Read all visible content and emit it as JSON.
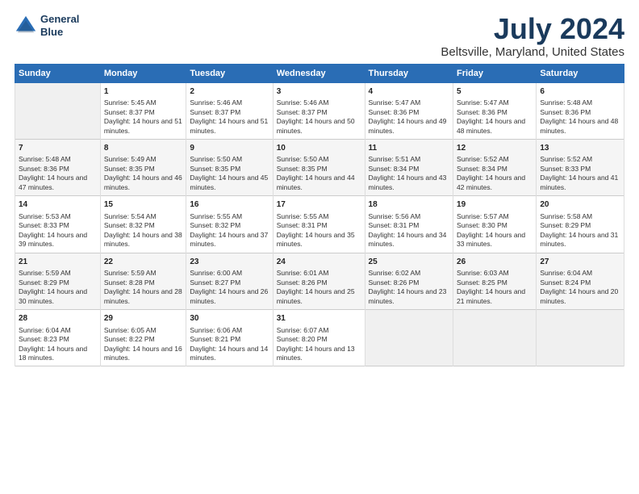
{
  "header": {
    "logo_line1": "General",
    "logo_line2": "Blue",
    "title": "July 2024",
    "subtitle": "Beltsville, Maryland, United States"
  },
  "calendar": {
    "days_of_week": [
      "Sunday",
      "Monday",
      "Tuesday",
      "Wednesday",
      "Thursday",
      "Friday",
      "Saturday"
    ],
    "weeks": [
      [
        {
          "day": "",
          "sunrise": "",
          "sunset": "",
          "daylight": ""
        },
        {
          "day": "1",
          "sunrise": "Sunrise: 5:45 AM",
          "sunset": "Sunset: 8:37 PM",
          "daylight": "Daylight: 14 hours and 51 minutes."
        },
        {
          "day": "2",
          "sunrise": "Sunrise: 5:46 AM",
          "sunset": "Sunset: 8:37 PM",
          "daylight": "Daylight: 14 hours and 51 minutes."
        },
        {
          "day": "3",
          "sunrise": "Sunrise: 5:46 AM",
          "sunset": "Sunset: 8:37 PM",
          "daylight": "Daylight: 14 hours and 50 minutes."
        },
        {
          "day": "4",
          "sunrise": "Sunrise: 5:47 AM",
          "sunset": "Sunset: 8:36 PM",
          "daylight": "Daylight: 14 hours and 49 minutes."
        },
        {
          "day": "5",
          "sunrise": "Sunrise: 5:47 AM",
          "sunset": "Sunset: 8:36 PM",
          "daylight": "Daylight: 14 hours and 48 minutes."
        },
        {
          "day": "6",
          "sunrise": "Sunrise: 5:48 AM",
          "sunset": "Sunset: 8:36 PM",
          "daylight": "Daylight: 14 hours and 48 minutes."
        }
      ],
      [
        {
          "day": "7",
          "sunrise": "Sunrise: 5:48 AM",
          "sunset": "Sunset: 8:36 PM",
          "daylight": "Daylight: 14 hours and 47 minutes."
        },
        {
          "day": "8",
          "sunrise": "Sunrise: 5:49 AM",
          "sunset": "Sunset: 8:35 PM",
          "daylight": "Daylight: 14 hours and 46 minutes."
        },
        {
          "day": "9",
          "sunrise": "Sunrise: 5:50 AM",
          "sunset": "Sunset: 8:35 PM",
          "daylight": "Daylight: 14 hours and 45 minutes."
        },
        {
          "day": "10",
          "sunrise": "Sunrise: 5:50 AM",
          "sunset": "Sunset: 8:35 PM",
          "daylight": "Daylight: 14 hours and 44 minutes."
        },
        {
          "day": "11",
          "sunrise": "Sunrise: 5:51 AM",
          "sunset": "Sunset: 8:34 PM",
          "daylight": "Daylight: 14 hours and 43 minutes."
        },
        {
          "day": "12",
          "sunrise": "Sunrise: 5:52 AM",
          "sunset": "Sunset: 8:34 PM",
          "daylight": "Daylight: 14 hours and 42 minutes."
        },
        {
          "day": "13",
          "sunrise": "Sunrise: 5:52 AM",
          "sunset": "Sunset: 8:33 PM",
          "daylight": "Daylight: 14 hours and 41 minutes."
        }
      ],
      [
        {
          "day": "14",
          "sunrise": "Sunrise: 5:53 AM",
          "sunset": "Sunset: 8:33 PM",
          "daylight": "Daylight: 14 hours and 39 minutes."
        },
        {
          "day": "15",
          "sunrise": "Sunrise: 5:54 AM",
          "sunset": "Sunset: 8:32 PM",
          "daylight": "Daylight: 14 hours and 38 minutes."
        },
        {
          "day": "16",
          "sunrise": "Sunrise: 5:55 AM",
          "sunset": "Sunset: 8:32 PM",
          "daylight": "Daylight: 14 hours and 37 minutes."
        },
        {
          "day": "17",
          "sunrise": "Sunrise: 5:55 AM",
          "sunset": "Sunset: 8:31 PM",
          "daylight": "Daylight: 14 hours and 35 minutes."
        },
        {
          "day": "18",
          "sunrise": "Sunrise: 5:56 AM",
          "sunset": "Sunset: 8:31 PM",
          "daylight": "Daylight: 14 hours and 34 minutes."
        },
        {
          "day": "19",
          "sunrise": "Sunrise: 5:57 AM",
          "sunset": "Sunset: 8:30 PM",
          "daylight": "Daylight: 14 hours and 33 minutes."
        },
        {
          "day": "20",
          "sunrise": "Sunrise: 5:58 AM",
          "sunset": "Sunset: 8:29 PM",
          "daylight": "Daylight: 14 hours and 31 minutes."
        }
      ],
      [
        {
          "day": "21",
          "sunrise": "Sunrise: 5:59 AM",
          "sunset": "Sunset: 8:29 PM",
          "daylight": "Daylight: 14 hours and 30 minutes."
        },
        {
          "day": "22",
          "sunrise": "Sunrise: 5:59 AM",
          "sunset": "Sunset: 8:28 PM",
          "daylight": "Daylight: 14 hours and 28 minutes."
        },
        {
          "day": "23",
          "sunrise": "Sunrise: 6:00 AM",
          "sunset": "Sunset: 8:27 PM",
          "daylight": "Daylight: 14 hours and 26 minutes."
        },
        {
          "day": "24",
          "sunrise": "Sunrise: 6:01 AM",
          "sunset": "Sunset: 8:26 PM",
          "daylight": "Daylight: 14 hours and 25 minutes."
        },
        {
          "day": "25",
          "sunrise": "Sunrise: 6:02 AM",
          "sunset": "Sunset: 8:26 PM",
          "daylight": "Daylight: 14 hours and 23 minutes."
        },
        {
          "day": "26",
          "sunrise": "Sunrise: 6:03 AM",
          "sunset": "Sunset: 8:25 PM",
          "daylight": "Daylight: 14 hours and 21 minutes."
        },
        {
          "day": "27",
          "sunrise": "Sunrise: 6:04 AM",
          "sunset": "Sunset: 8:24 PM",
          "daylight": "Daylight: 14 hours and 20 minutes."
        }
      ],
      [
        {
          "day": "28",
          "sunrise": "Sunrise: 6:04 AM",
          "sunset": "Sunset: 8:23 PM",
          "daylight": "Daylight: 14 hours and 18 minutes."
        },
        {
          "day": "29",
          "sunrise": "Sunrise: 6:05 AM",
          "sunset": "Sunset: 8:22 PM",
          "daylight": "Daylight: 14 hours and 16 minutes."
        },
        {
          "day": "30",
          "sunrise": "Sunrise: 6:06 AM",
          "sunset": "Sunset: 8:21 PM",
          "daylight": "Daylight: 14 hours and 14 minutes."
        },
        {
          "day": "31",
          "sunrise": "Sunrise: 6:07 AM",
          "sunset": "Sunset: 8:20 PM",
          "daylight": "Daylight: 14 hours and 13 minutes."
        },
        {
          "day": "",
          "sunrise": "",
          "sunset": "",
          "daylight": ""
        },
        {
          "day": "",
          "sunrise": "",
          "sunset": "",
          "daylight": ""
        },
        {
          "day": "",
          "sunrise": "",
          "sunset": "",
          "daylight": ""
        }
      ]
    ]
  }
}
